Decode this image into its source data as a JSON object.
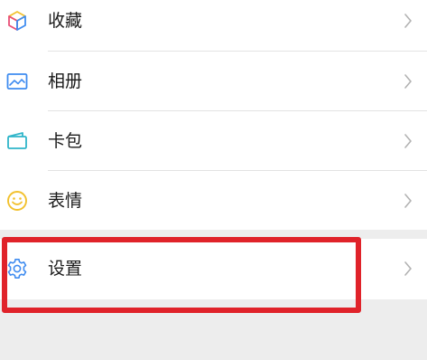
{
  "menu": {
    "items": [
      {
        "label": "收藏",
        "icon": "favorites-cube-icon"
      },
      {
        "label": "相册",
        "icon": "album-picture-icon"
      },
      {
        "label": "卡包",
        "icon": "card-wallet-icon"
      },
      {
        "label": "表情",
        "icon": "emoji-smile-icon"
      }
    ],
    "settings": {
      "label": "设置",
      "icon": "gear-icon"
    },
    "chevron_icon": "chevron-right-icon"
  },
  "colors": {
    "background": "#ededed",
    "row_background": "#ffffff",
    "highlight_border": "#e0232a",
    "chevron": "#b2b2b2",
    "divider": "#e3e3e3"
  }
}
